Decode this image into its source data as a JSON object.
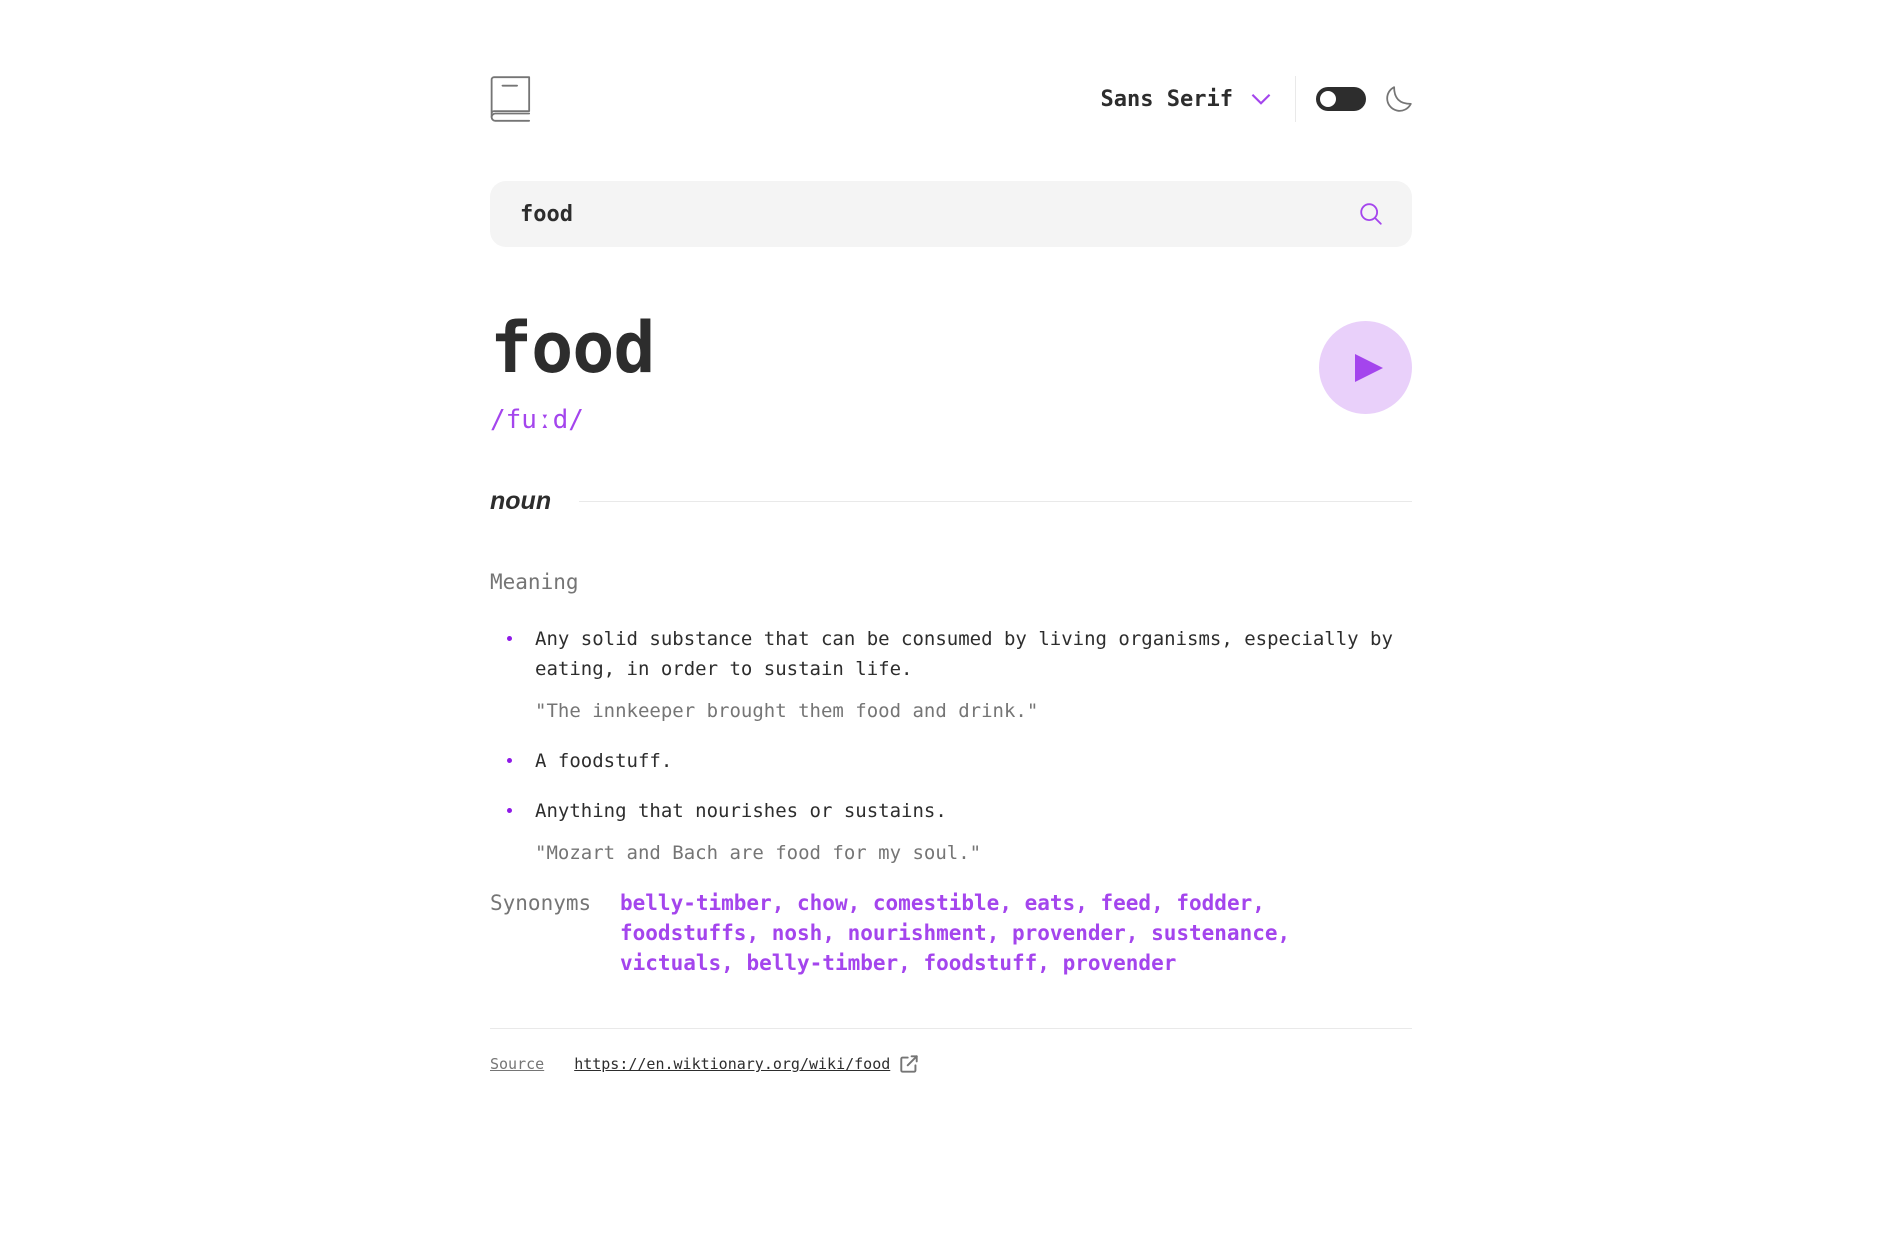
{
  "header": {
    "logo_icon": "book-icon",
    "font_select": {
      "selected": "Sans Serif",
      "icon": "chevron-down-icon"
    },
    "theme_toggle": {
      "state": "off",
      "icon": "moon-icon"
    }
  },
  "search": {
    "value": "food",
    "icon": "search-icon"
  },
  "word": {
    "text": "food",
    "phonetic": "/fuːd/",
    "play_icon": "play-icon"
  },
  "meaning": {
    "part_of_speech": "noun",
    "heading": "Meaning",
    "definitions": [
      {
        "text": "Any solid substance that can be consumed by living organisms, especially by eating, in order to sustain life.",
        "example": "\"The innkeeper brought them food and drink.\""
      },
      {
        "text": "A foodstuff."
      },
      {
        "text": "Anything that nourishes or sustains.",
        "example": "\"Mozart and Bach are food for my soul.\""
      }
    ],
    "synonyms_label": "Synonyms",
    "synonyms": [
      "belly-timber",
      "chow",
      "comestible",
      "eats",
      "feed",
      "fodder",
      "foodstuffs",
      "nosh",
      "nourishment",
      "provender",
      "sustenance",
      "victuals",
      "belly-timber",
      "foodstuff",
      "provender"
    ]
  },
  "source": {
    "label": "Source",
    "url": "https://en.wiktionary.org/wiki/food",
    "icon": "external-link-icon"
  },
  "colors": {
    "accent": "#a445ed",
    "accent_light": "#e9d0fa",
    "text": "#2d2d2d",
    "muted": "#757575",
    "search_bg": "#f4f4f4"
  }
}
